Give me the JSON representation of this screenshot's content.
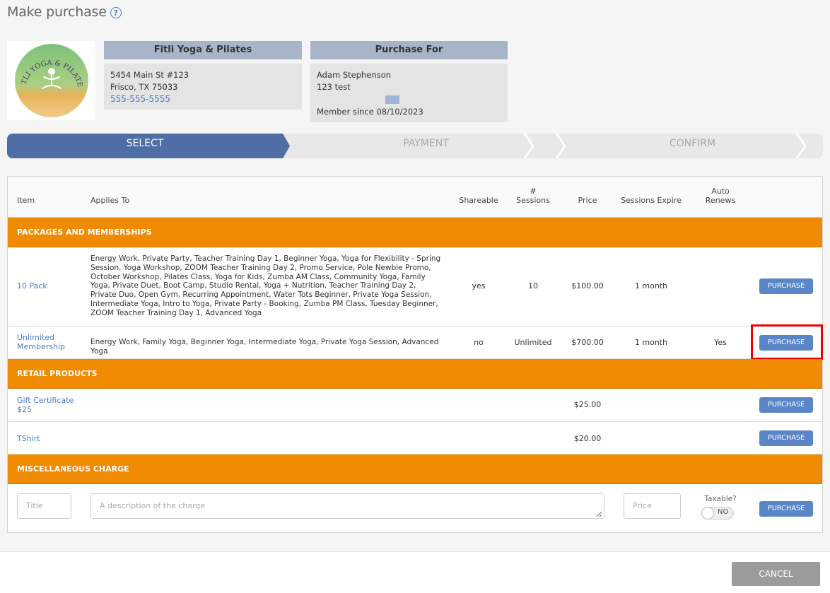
{
  "page": {
    "title": "Make purchase"
  },
  "business": {
    "name": "Fitli Yoga & Pilates",
    "address1": "5454 Main St #123",
    "address2": "Frisco, TX 75033",
    "phone": "555-555-5555",
    "logo_text": "FITLI YOGA & PILATES"
  },
  "purchaser": {
    "header": "Purchase For",
    "name": "Adam Stephenson",
    "note": "123 test",
    "member_since": "Member since 08/10/2023"
  },
  "steps": [
    "SELECT",
    "PAYMENT",
    "CONFIRM"
  ],
  "columns": {
    "item": "Item",
    "applies_to": "Applies To",
    "shareable": "Shareable",
    "sessions_hash": "#",
    "sessions": "Sessions",
    "price": "Price",
    "expire": "Sessions Expire",
    "auto": "Auto",
    "renews": "Renews"
  },
  "sections": {
    "packages": "PACKAGES AND MEMBERSHIPS",
    "retail": "RETAIL PRODUCTS",
    "misc": "MISCELLANEOUS CHARGE"
  },
  "packages": [
    {
      "item": "10 Pack",
      "applies_to": "Energy Work, Private Party, Teacher Training Day 1, Beginner Yoga, Yoga for Flexibility - Spring Session, Yoga Workshop, ZOOM Teacher Training Day 2, Promo Service, Pole Newbie Promo, October Workshop, Pilates Class, Yoga for Kids, Zumba AM Class, Community Yoga, Family Yoga, Private Duet, Boot Camp, Studio Rental, Yoga + Nutrition, Teacher Training Day 2, Private Duo, Open Gym, Recurring Appointment, Water Tots Beginner, Private Yoga Session, Intermediate Yoga, Intro to Yoga, Private Party - Booking, Zumba PM Class, Tuesday Beginner, ZOOM Teacher Training Day 1, Advanced Yoga",
      "shareable": "yes",
      "sessions": "10",
      "price": "$100.00",
      "expire": "1 month",
      "auto_renews": ""
    },
    {
      "item": "Unlimited Membership",
      "applies_to": "Energy Work, Family Yoga, Beginner Yoga, Intermediate Yoga, Private Yoga Session, Advanced Yoga",
      "shareable": "no",
      "sessions": "Unlimited",
      "price": "$700.00",
      "expire": "1 month",
      "auto_renews": "Yes"
    }
  ],
  "retail": [
    {
      "item": "Gift Certificate $25",
      "price": "$25.00"
    },
    {
      "item": "TShirt",
      "price": "$20.00"
    }
  ],
  "misc": {
    "title_placeholder": "Title",
    "description_placeholder": "A description of the charge",
    "price_placeholder": "Price",
    "taxable_label": "Taxable?",
    "taxable_value": "NO"
  },
  "buttons": {
    "purchase": "PURCHASE",
    "cancel": "CANCEL"
  },
  "colors": {
    "accent": "#4e6ea5",
    "section": "#f08a00",
    "button": "#5a86c8",
    "highlight": "#ee0000"
  }
}
